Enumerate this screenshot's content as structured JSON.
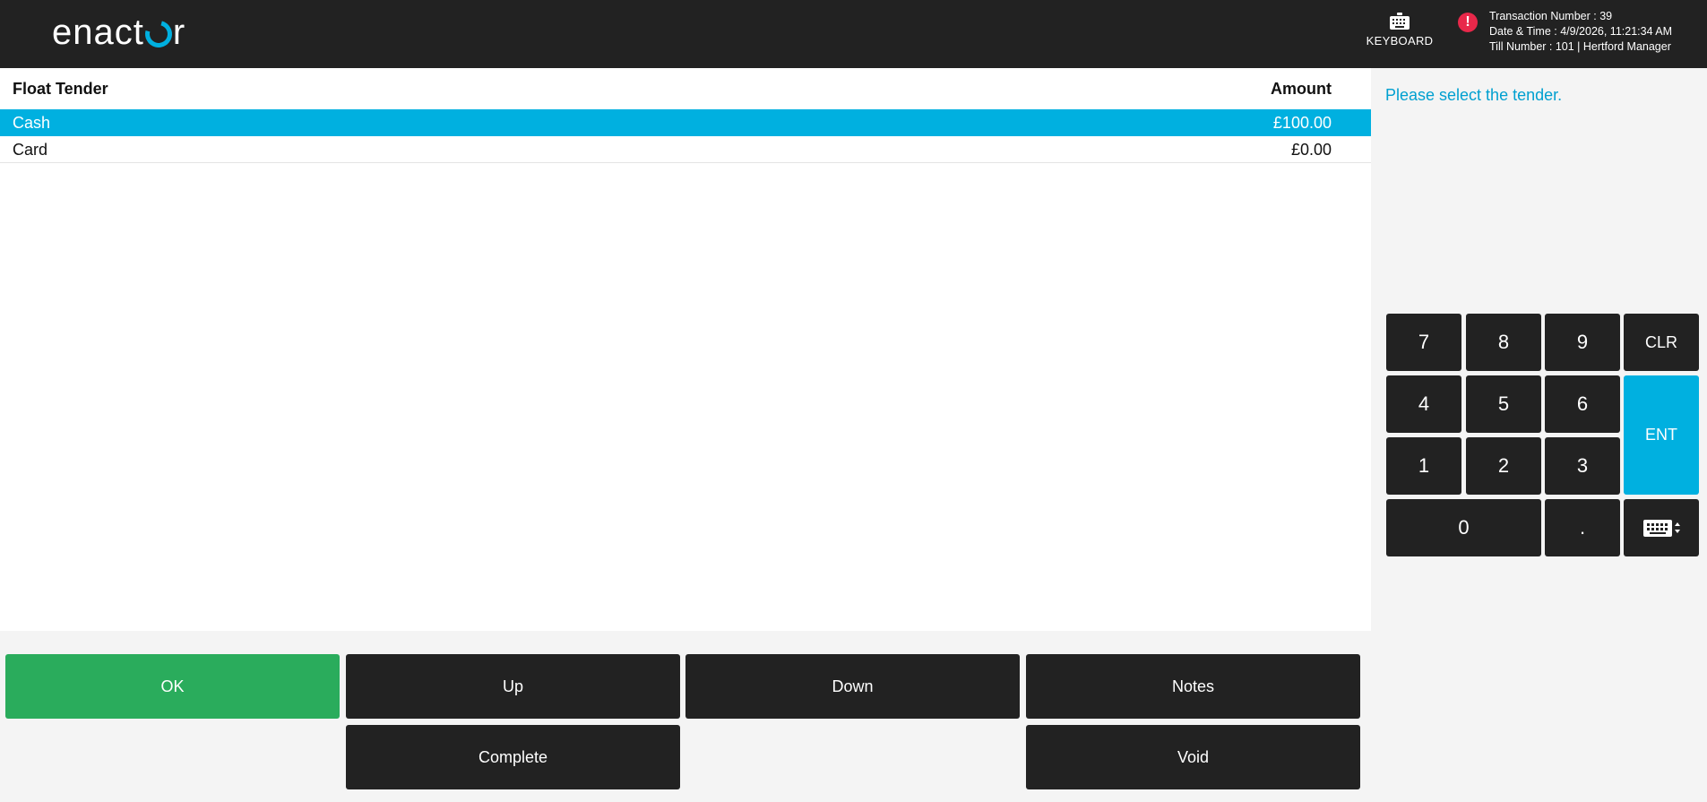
{
  "header": {
    "logo_left": "enact",
    "logo_right": "r",
    "keyboard_label": "KEYBOARD",
    "alert_glyph": "!",
    "transaction_number": "Transaction Number : 39",
    "date_time": "Date & Time : 4/9/2026, 11:21:34 AM",
    "till_number": "Till Number : 101 | Hertford Manager"
  },
  "table": {
    "headers": {
      "tender": "Float Tender",
      "amount": "Amount"
    },
    "rows": [
      {
        "tender": "Cash",
        "amount": "£100.00",
        "selected": true
      },
      {
        "tender": "Card",
        "amount": "£0.00",
        "selected": false
      }
    ]
  },
  "side": {
    "prompt": "Please select the tender."
  },
  "keypad": {
    "k7": "7",
    "k8": "8",
    "k9": "9",
    "clr": "CLR",
    "k4": "4",
    "k5": "5",
    "k6": "6",
    "ent": "ENT",
    "k1": "1",
    "k2": "2",
    "k3": "3",
    "k0": "0",
    "dot": ".",
    "keyboard_toggle_icon": "keyboard-toggle-icon"
  },
  "buttons": {
    "ok": "OK",
    "up": "Up",
    "down": "Down",
    "notes": "Notes",
    "complete": "Complete",
    "void": "Void"
  },
  "colors": {
    "header_bg": "#222222",
    "accent": "#00b0e0",
    "ok_green": "#2aac5c",
    "alert_red": "#e8284a",
    "button_dark": "#222222"
  }
}
